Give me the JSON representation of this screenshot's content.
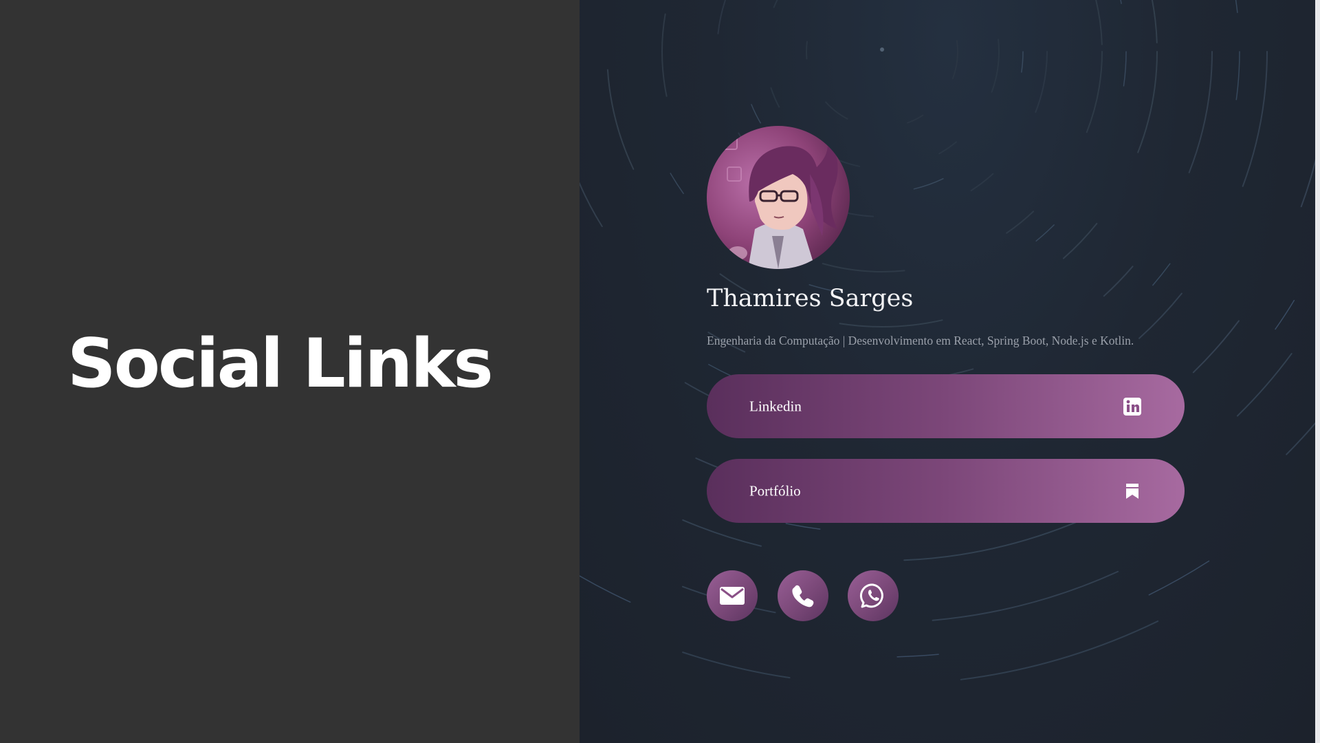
{
  "slide": {
    "title": "Social Links"
  },
  "profile": {
    "name": "Thamires Sarges",
    "bio": "Engenharia da Computação | Desenvolvimento em React, Spring Boot, Node.js e Kotlin.",
    "avatar_icon": "avatar-illustration"
  },
  "links": [
    {
      "label": "Linkedin",
      "icon": "linkedin-icon"
    },
    {
      "label": "Portfólio",
      "icon": "bookmark-icon"
    }
  ],
  "social": [
    {
      "icon": "email-icon"
    },
    {
      "icon": "phone-icon"
    },
    {
      "icon": "whatsapp-icon"
    }
  ],
  "colors": {
    "left_background": "#333333",
    "right_background": "#1f2733",
    "button_gradient_start": "#5a2f5c",
    "button_gradient_end": "#a76aa0",
    "text_primary": "#ffffff",
    "text_secondary": "#9aa0aa"
  }
}
